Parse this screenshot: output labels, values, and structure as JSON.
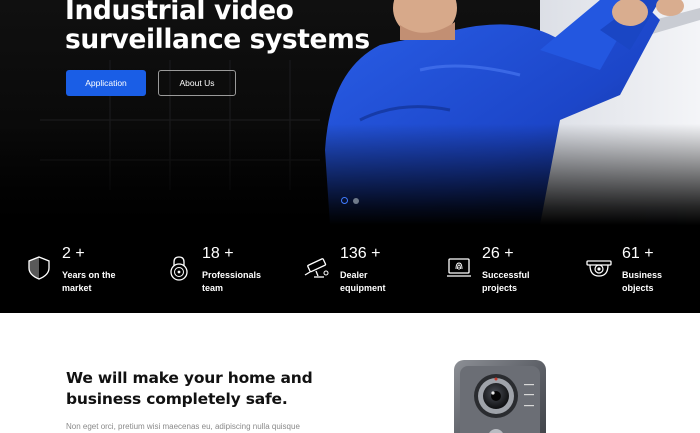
{
  "hero": {
    "title_line1": "Industrial video",
    "title_line2": "surveillance systems",
    "buttons": [
      {
        "label": "Application"
      },
      {
        "label": "About Us"
      }
    ],
    "slider": {
      "slides": 2,
      "active": 1
    }
  },
  "stats": [
    {
      "number": "2 +",
      "label_line1": "Years on the",
      "label_line2": "market",
      "icon": "shield-icon"
    },
    {
      "number": "18 +",
      "label_line1": "Professionals",
      "label_line2": "team",
      "icon": "padlock-icon"
    },
    {
      "number": "136 +",
      "label_line1": "Dealer",
      "label_line2": "equipment",
      "icon": "security-camera-icon"
    },
    {
      "number": "26 +",
      "label_line1": "Successful",
      "label_line2": "projects",
      "icon": "fingerprint-laptop-icon"
    },
    {
      "number": "61 +",
      "label_line1": "Business",
      "label_line2": "objects",
      "icon": "dome-camera-icon"
    }
  ],
  "content": {
    "title_line1": "We will make your home and",
    "title_line2": "business completely safe.",
    "text": "Non eget orci, pretium wisi maecenas eu, adipiscing nulla quisque"
  },
  "colors": {
    "accent": "#1a5ee6",
    "stats_background": "#000000",
    "worker_shirt": "#1f4fd8"
  }
}
